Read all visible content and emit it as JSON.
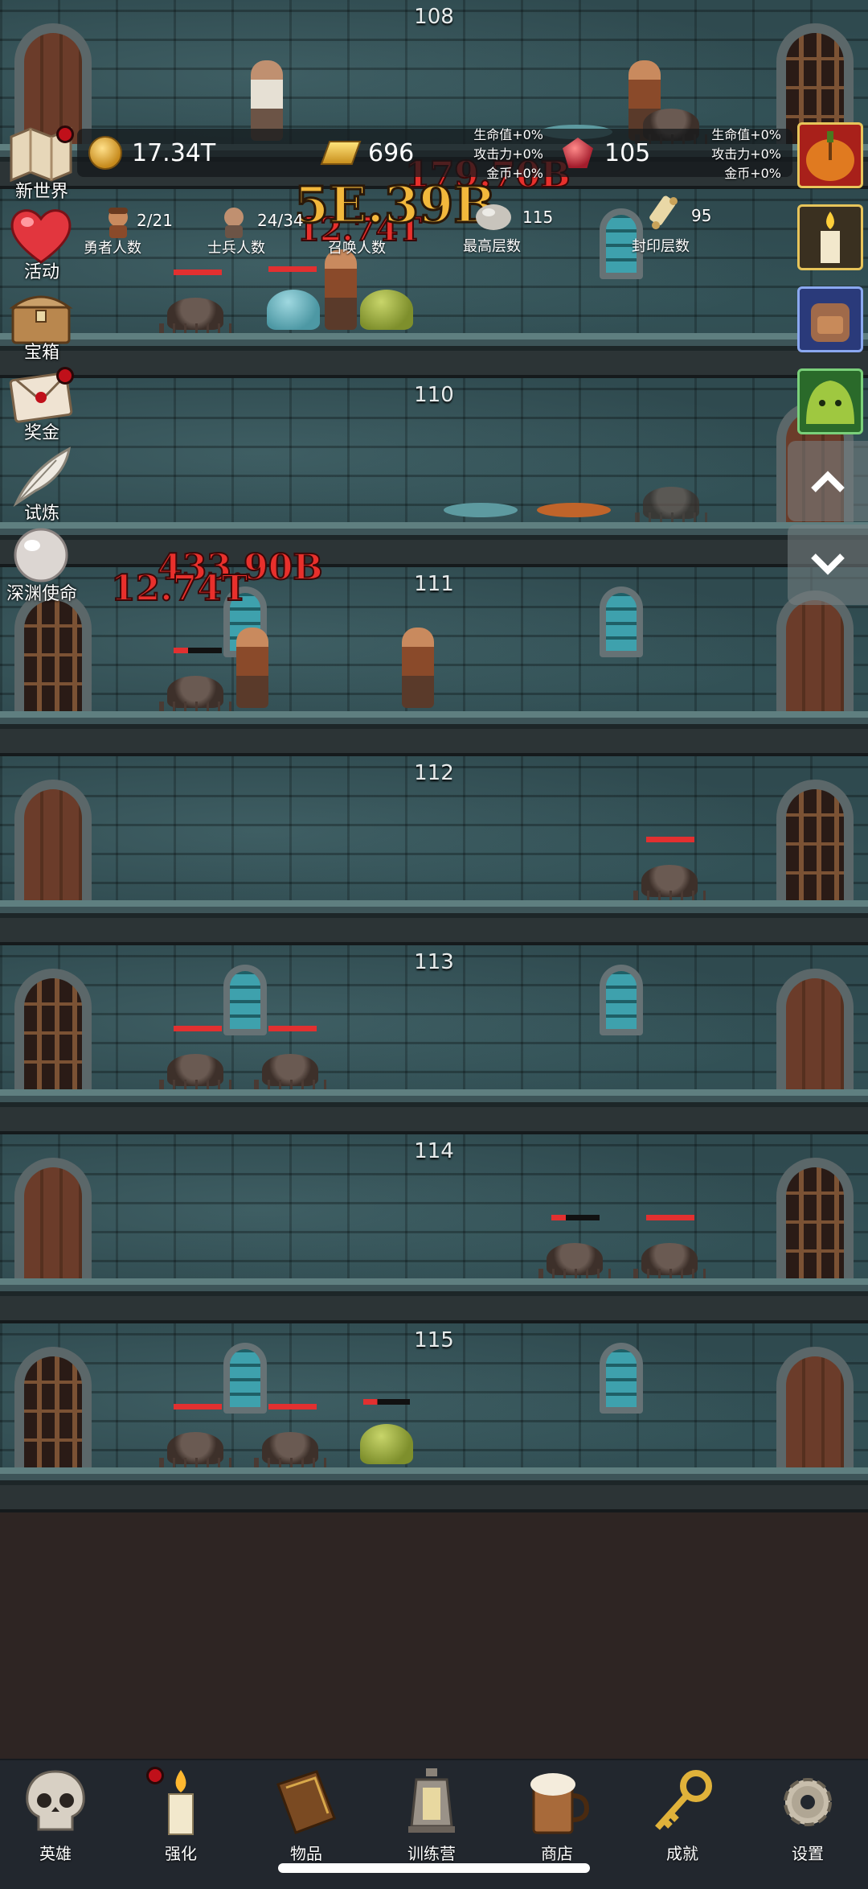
{
  "floors": [
    {
      "number": "108"
    },
    {
      "number": "110"
    },
    {
      "number": "111"
    },
    {
      "number": "112"
    },
    {
      "number": "113"
    },
    {
      "number": "114"
    },
    {
      "number": "115"
    }
  ],
  "resources": {
    "coins": "17.34T",
    "gold_bars": "696",
    "gems": "105"
  },
  "bonuses": {
    "mid": [
      "生命值+0%",
      "攻击力+0%",
      "金币+0%"
    ],
    "right": [
      "生命值+0%",
      "攻击力+0%",
      "金币+0%"
    ]
  },
  "stats": {
    "heroes": {
      "value": "2/21",
      "label": "勇者人数"
    },
    "soldiers": {
      "value": "24/34",
      "label": "士兵人数"
    },
    "summons": {
      "label": "召唤人数"
    },
    "max_floor": {
      "value": "115",
      "label": "最高层数"
    },
    "sealed_floor": {
      "value": "95",
      "label": "封印层数"
    }
  },
  "damage_numbers": {
    "big": "5E.39B",
    "red_top": "179.70B",
    "red_mid": "12.74T",
    "red_a": "433.90B",
    "red_b": "12.74T"
  },
  "left_menu": [
    {
      "label": "新世界",
      "icon": "map-icon"
    },
    {
      "label": "活动",
      "icon": "heart-icon"
    },
    {
      "label": "宝箱",
      "icon": "treasure-chest-icon"
    },
    {
      "label": "奖金",
      "icon": "envelope-icon"
    },
    {
      "label": "试炼",
      "icon": "feather-icon"
    },
    {
      "label": "深渊使命",
      "icon": "pearl-icon"
    }
  ],
  "bottom_nav": [
    {
      "label": "英雄",
      "icon": "skull-icon"
    },
    {
      "label": "强化",
      "icon": "candle-icon"
    },
    {
      "label": "物品",
      "icon": "book-icon"
    },
    {
      "label": "训练营",
      "icon": "lantern-icon"
    },
    {
      "label": "商店",
      "icon": "beer-mug-icon"
    },
    {
      "label": "成就",
      "icon": "key-icon"
    },
    {
      "label": "设置",
      "icon": "gear-icon"
    }
  ],
  "colors": {
    "wall": "#2f4a4f",
    "background": "#2e2523",
    "nav_bar": "#22272e",
    "damage_red": "#e8302c",
    "damage_gold": "#f2b83c",
    "hp_bar": "#e23030",
    "notification": "#c0101a"
  }
}
